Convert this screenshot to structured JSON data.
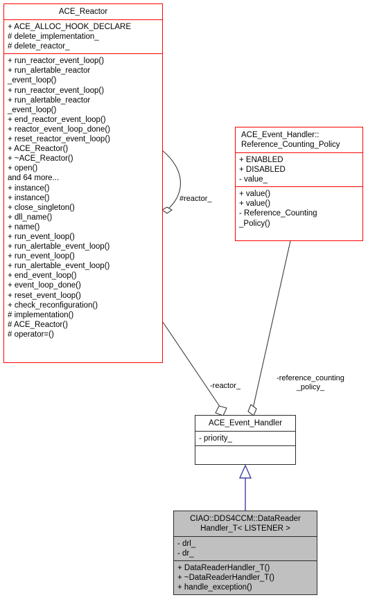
{
  "diagram": {
    "kind": "uml-class-collaboration-diagram",
    "colors": {
      "focus_border": "#ff0000",
      "plain_border": "#2b2b2b",
      "highlight_fill": "#c0c0c0",
      "inheritance": "#3f3fa8",
      "association": "#3a3a3a"
    }
  },
  "classes": {
    "ace_reactor": {
      "name": "ACE_Reactor",
      "attributes": [
        "+ ACE_ALLOC_HOOK_DECLARE",
        "# delete_implementation_",
        "# delete_reactor_"
      ],
      "operations": [
        "+ run_reactor_event_loop()",
        "+ run_alertable_reactor",
        "_event_loop()",
        "+ run_reactor_event_loop()",
        "+ run_alertable_reactor",
        "_event_loop()",
        "+ end_reactor_event_loop()",
        "+ reactor_event_loop_done()",
        "+ reset_reactor_event_loop()",
        "+ ACE_Reactor()",
        "+ ~ACE_Reactor()",
        "+ open()",
        "and 64 more...",
        "+ instance()",
        "+ instance()",
        "+ close_singleton()",
        "+ dll_name()",
        "+ name()",
        "+ run_event_loop()",
        "+ run_alertable_event_loop()",
        "+ run_event_loop()",
        "+ run_alertable_event_loop()",
        "+ end_event_loop()",
        "+ event_loop_done()",
        "+ reset_event_loop()",
        "+ check_reconfiguration()",
        "# implementation()",
        "# ACE_Reactor()",
        "# operator=()"
      ]
    },
    "reference_counting_policy": {
      "name": "ACE_Event_Handler::\nReference_Counting_Policy",
      "attributes": [
        "+ ENABLED",
        "+ DISABLED",
        "- value_"
      ],
      "operations": [
        "+ value()",
        "+ value()",
        "- Reference_Counting",
        "_Policy()"
      ]
    },
    "ace_event_handler": {
      "name": "ACE_Event_Handler",
      "attributes": [
        "- priority_"
      ],
      "operations": []
    },
    "data_reader_handler": {
      "name": "CIAO::DDS4CCM::DataReader\nHandler_T< LISTENER >",
      "attributes": [
        "- drl_",
        "- dr_"
      ],
      "operations": [
        "+ DataReaderHandler_T()",
        "+ ~DataReaderHandler_T()",
        "+ handle_exception()"
      ]
    }
  },
  "edges": {
    "reactor_self": {
      "label": "#reactor_"
    },
    "handler_reactor": {
      "label": "-reactor_"
    },
    "handler_policy": {
      "label": "-reference_counting\n_policy_"
    }
  }
}
